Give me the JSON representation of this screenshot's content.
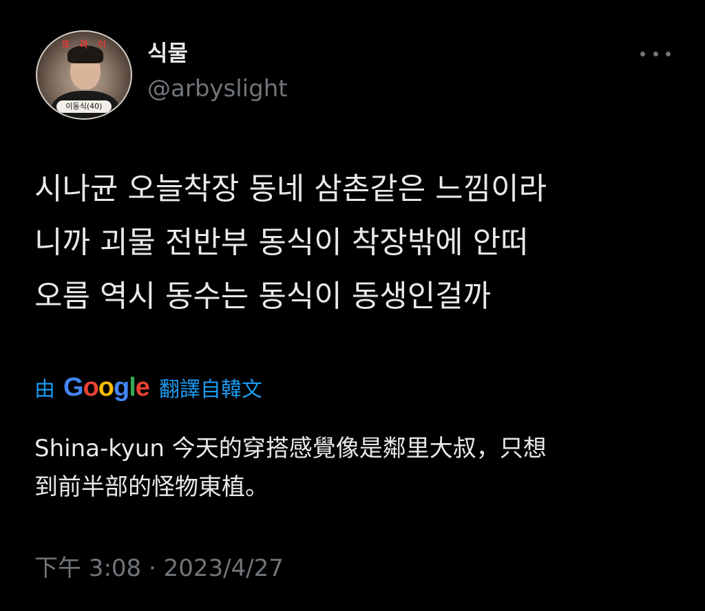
{
  "tweet": {
    "author": {
      "display_name": "식물",
      "handle": "@arbyslight",
      "avatar": {
        "top_text": "또라이",
        "bottom_label": "이동식(40)"
      }
    },
    "text_lines": [
      "시나균 오늘착장 동네 삼촌같은 느낌이라",
      "니까 괴물 전반부 동식이 착장밖에 안떠",
      "오름 역시 동수는 동식이 동생인걸까"
    ],
    "translation": {
      "prefix": "由",
      "provider_letters": [
        {
          "char": "G",
          "color": "#4285F4"
        },
        {
          "char": "o",
          "color": "#EA4335"
        },
        {
          "char": "o",
          "color": "#FBBC05"
        },
        {
          "char": "g",
          "color": "#4285F4"
        },
        {
          "char": "l",
          "color": "#34A853"
        },
        {
          "char": "e",
          "color": "#EA4335"
        }
      ],
      "suffix": "翻譯自韓文",
      "text_lines": [
        "Shina-kyun 今天的穿搭感覺像是鄰里大叔，只想",
        "到前半部的怪物東植。"
      ]
    },
    "timestamp": "下午 3:08 · 2023/4/27",
    "more_icon": "more-horizontal-icon"
  },
  "colors": {
    "background": "#000000",
    "primary_text": "#e7e9ea",
    "secondary_text": "#71767b",
    "link": "#1d9bf0"
  }
}
